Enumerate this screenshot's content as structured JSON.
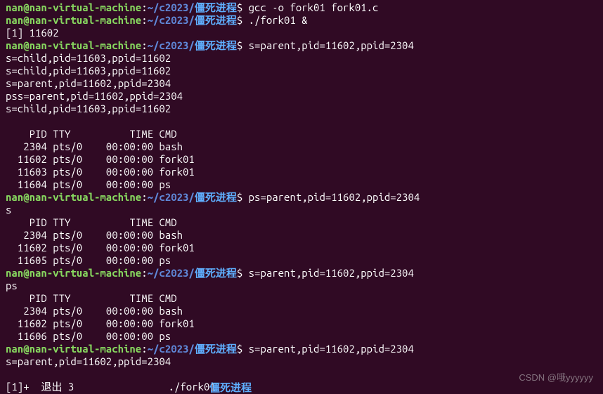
{
  "prompt": {
    "user": "nan@nan-virtual-machine",
    "colon": ":",
    "path": "~/c2023/",
    "subdir": "僵死进程",
    "dollar": "$ "
  },
  "lines": [
    {
      "type": "prompt",
      "cmd": "gcc -o fork01 fork01.c"
    },
    {
      "type": "prompt",
      "cmd": "./fork01 &"
    },
    {
      "type": "text",
      "text": "[1] 11602"
    },
    {
      "type": "prompt",
      "cmd": "s=parent,pid=11602,ppid=2304"
    },
    {
      "type": "text",
      "text": "s=child,pid=11603,ppid=11602"
    },
    {
      "type": "text",
      "text": "s=child,pid=11603,ppid=11602"
    },
    {
      "type": "text",
      "text": "s=parent,pid=11602,ppid=2304"
    },
    {
      "type": "text",
      "text": "pss=parent,pid=11602,ppid=2304"
    },
    {
      "type": "text",
      "text": "s=child,pid=11603,ppid=11602"
    },
    {
      "type": "text",
      "text": ""
    },
    {
      "type": "text",
      "text": "    PID TTY          TIME CMD"
    },
    {
      "type": "text",
      "text": "   2304 pts/0    00:00:00 bash"
    },
    {
      "type": "text",
      "text": "  11602 pts/0    00:00:00 fork01"
    },
    {
      "type": "text",
      "text": "  11603 pts/0    00:00:00 fork01"
    },
    {
      "type": "text",
      "text": "  11604 pts/0    00:00:00 ps"
    },
    {
      "type": "prompt",
      "cmd": "ps=parent,pid=11602,ppid=2304"
    },
    {
      "type": "text",
      "text": "s"
    },
    {
      "type": "text",
      "text": "    PID TTY          TIME CMD"
    },
    {
      "type": "text",
      "text": "   2304 pts/0    00:00:00 bash"
    },
    {
      "type": "text",
      "text": "  11602 pts/0    00:00:00 fork01"
    },
    {
      "type": "text",
      "text": "  11605 pts/0    00:00:00 ps"
    },
    {
      "type": "prompt",
      "cmd": "s=parent,pid=11602,ppid=2304"
    },
    {
      "type": "text",
      "text": "ps"
    },
    {
      "type": "text",
      "text": "    PID TTY          TIME CMD"
    },
    {
      "type": "text",
      "text": "   2304 pts/0    00:00:00 bash"
    },
    {
      "type": "text",
      "text": "  11602 pts/0    00:00:00 fork01"
    },
    {
      "type": "text",
      "text": "  11606 pts/0    00:00:00 ps"
    },
    {
      "type": "prompt",
      "cmd": "s=parent,pid=11602,ppid=2304"
    },
    {
      "type": "text",
      "text": "s=parent,pid=11602,ppid=2304"
    },
    {
      "type": "text",
      "text": ""
    },
    {
      "type": "text",
      "text": "[1]+  退出 3                ./fork01"
    }
  ],
  "bottom_highlight": "僵死进程",
  "watermark": "CSDN @哦yyyyyy"
}
